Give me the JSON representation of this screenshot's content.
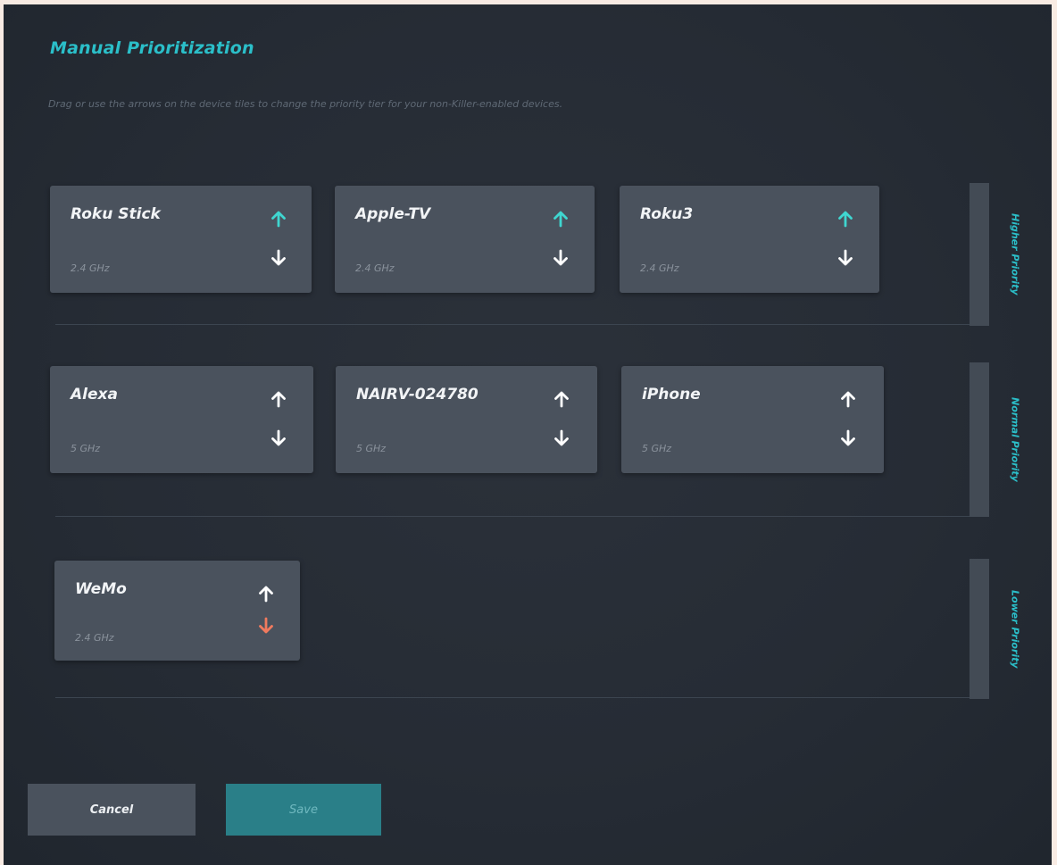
{
  "header": {
    "title": "Manual Prioritization",
    "subtitle": "Drag or use the arrows on the device tiles to change the priority tier for your non-Killer-enabled devices."
  },
  "tiers": [
    {
      "label": "Higher Priority",
      "devices": [
        {
          "name": "Roku Stick",
          "band": "2.4 GHz",
          "up_icon": "arrow-up-icon",
          "down_icon": "arrow-down-icon",
          "up_color": "#3fd6d0",
          "down_color": "#ffffff"
        },
        {
          "name": "Apple-TV",
          "band": "2.4 GHz",
          "up_icon": "arrow-up-icon",
          "down_icon": "arrow-down-icon",
          "up_color": "#3fd6d0",
          "down_color": "#ffffff"
        },
        {
          "name": "Roku3",
          "band": "2.4 GHz",
          "up_icon": "arrow-up-icon",
          "down_icon": "arrow-down-icon",
          "up_color": "#3fd6d0",
          "down_color": "#ffffff"
        }
      ]
    },
    {
      "label": "Normal Priority",
      "devices": [
        {
          "name": "Alexa",
          "band": "5 GHz",
          "up_icon": "arrow-up-icon",
          "down_icon": "arrow-down-icon",
          "up_color": "#ffffff",
          "down_color": "#ffffff"
        },
        {
          "name": "NAIRV-024780",
          "band": "5 GHz",
          "up_icon": "arrow-up-icon",
          "down_icon": "arrow-down-icon",
          "up_color": "#ffffff",
          "down_color": "#ffffff"
        },
        {
          "name": "iPhone",
          "band": "5 GHz",
          "up_icon": "arrow-up-icon",
          "down_icon": "arrow-down-icon",
          "up_color": "#ffffff",
          "down_color": "#ffffff"
        }
      ]
    },
    {
      "label": "Lower Priority",
      "devices": [
        {
          "name": "WeMo",
          "band": "2.4 GHz",
          "up_icon": "arrow-up-icon",
          "down_icon": "arrow-down-icon",
          "up_color": "#ffffff",
          "down_color": "#f07a5e"
        }
      ]
    }
  ],
  "buttons": {
    "cancel_label": "Cancel",
    "save_label": "Save"
  },
  "colors": {
    "accent": "#2bbfc9",
    "save_bg": "#2a7f88"
  }
}
